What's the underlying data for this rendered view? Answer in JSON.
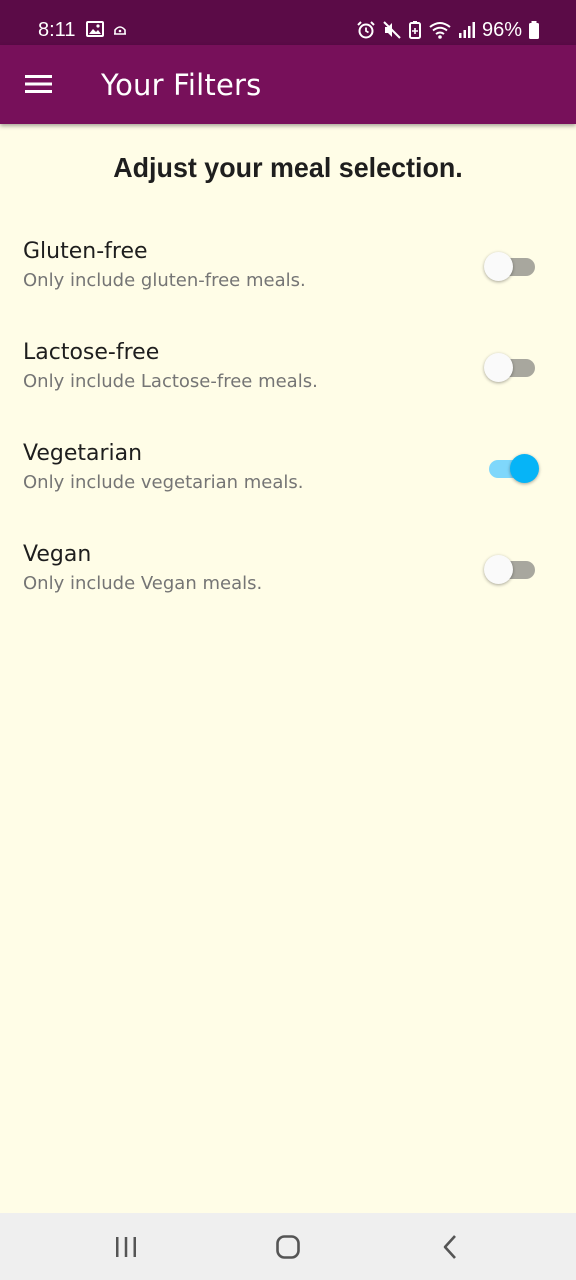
{
  "status_bar": {
    "time": "8:11",
    "battery": "96%",
    "icons_left": [
      "image-icon",
      "app-notification-icon"
    ],
    "icons_right": [
      "alarm-icon",
      "mute-icon",
      "battery-saver-icon",
      "wifi-icon",
      "signal-icon",
      "battery-icon"
    ]
  },
  "app_bar": {
    "title": "Your Filters",
    "menu_icon": "hamburger-menu-icon",
    "background": "#77105a"
  },
  "page": {
    "heading": "Adjust your meal selection.",
    "background": "#fffde7"
  },
  "filters": [
    {
      "title": "Gluten-free",
      "subtitle": "Only include gluten-free meals.",
      "enabled": false
    },
    {
      "title": "Lactose-free",
      "subtitle": "Only include Lactose-free meals.",
      "enabled": false
    },
    {
      "title": "Vegetarian",
      "subtitle": "Only include vegetarian meals.",
      "enabled": true
    },
    {
      "title": "Vegan",
      "subtitle": "Only include Vegan meals.",
      "enabled": false
    }
  ],
  "switch_colors": {
    "on_thumb": "#06b4f7",
    "on_track": "#7fd7fb",
    "off_thumb": "#fafafa",
    "off_track": "#a8a79e"
  },
  "nav_bar": {
    "buttons": [
      "recent-apps-icon",
      "home-icon",
      "back-icon"
    ]
  }
}
